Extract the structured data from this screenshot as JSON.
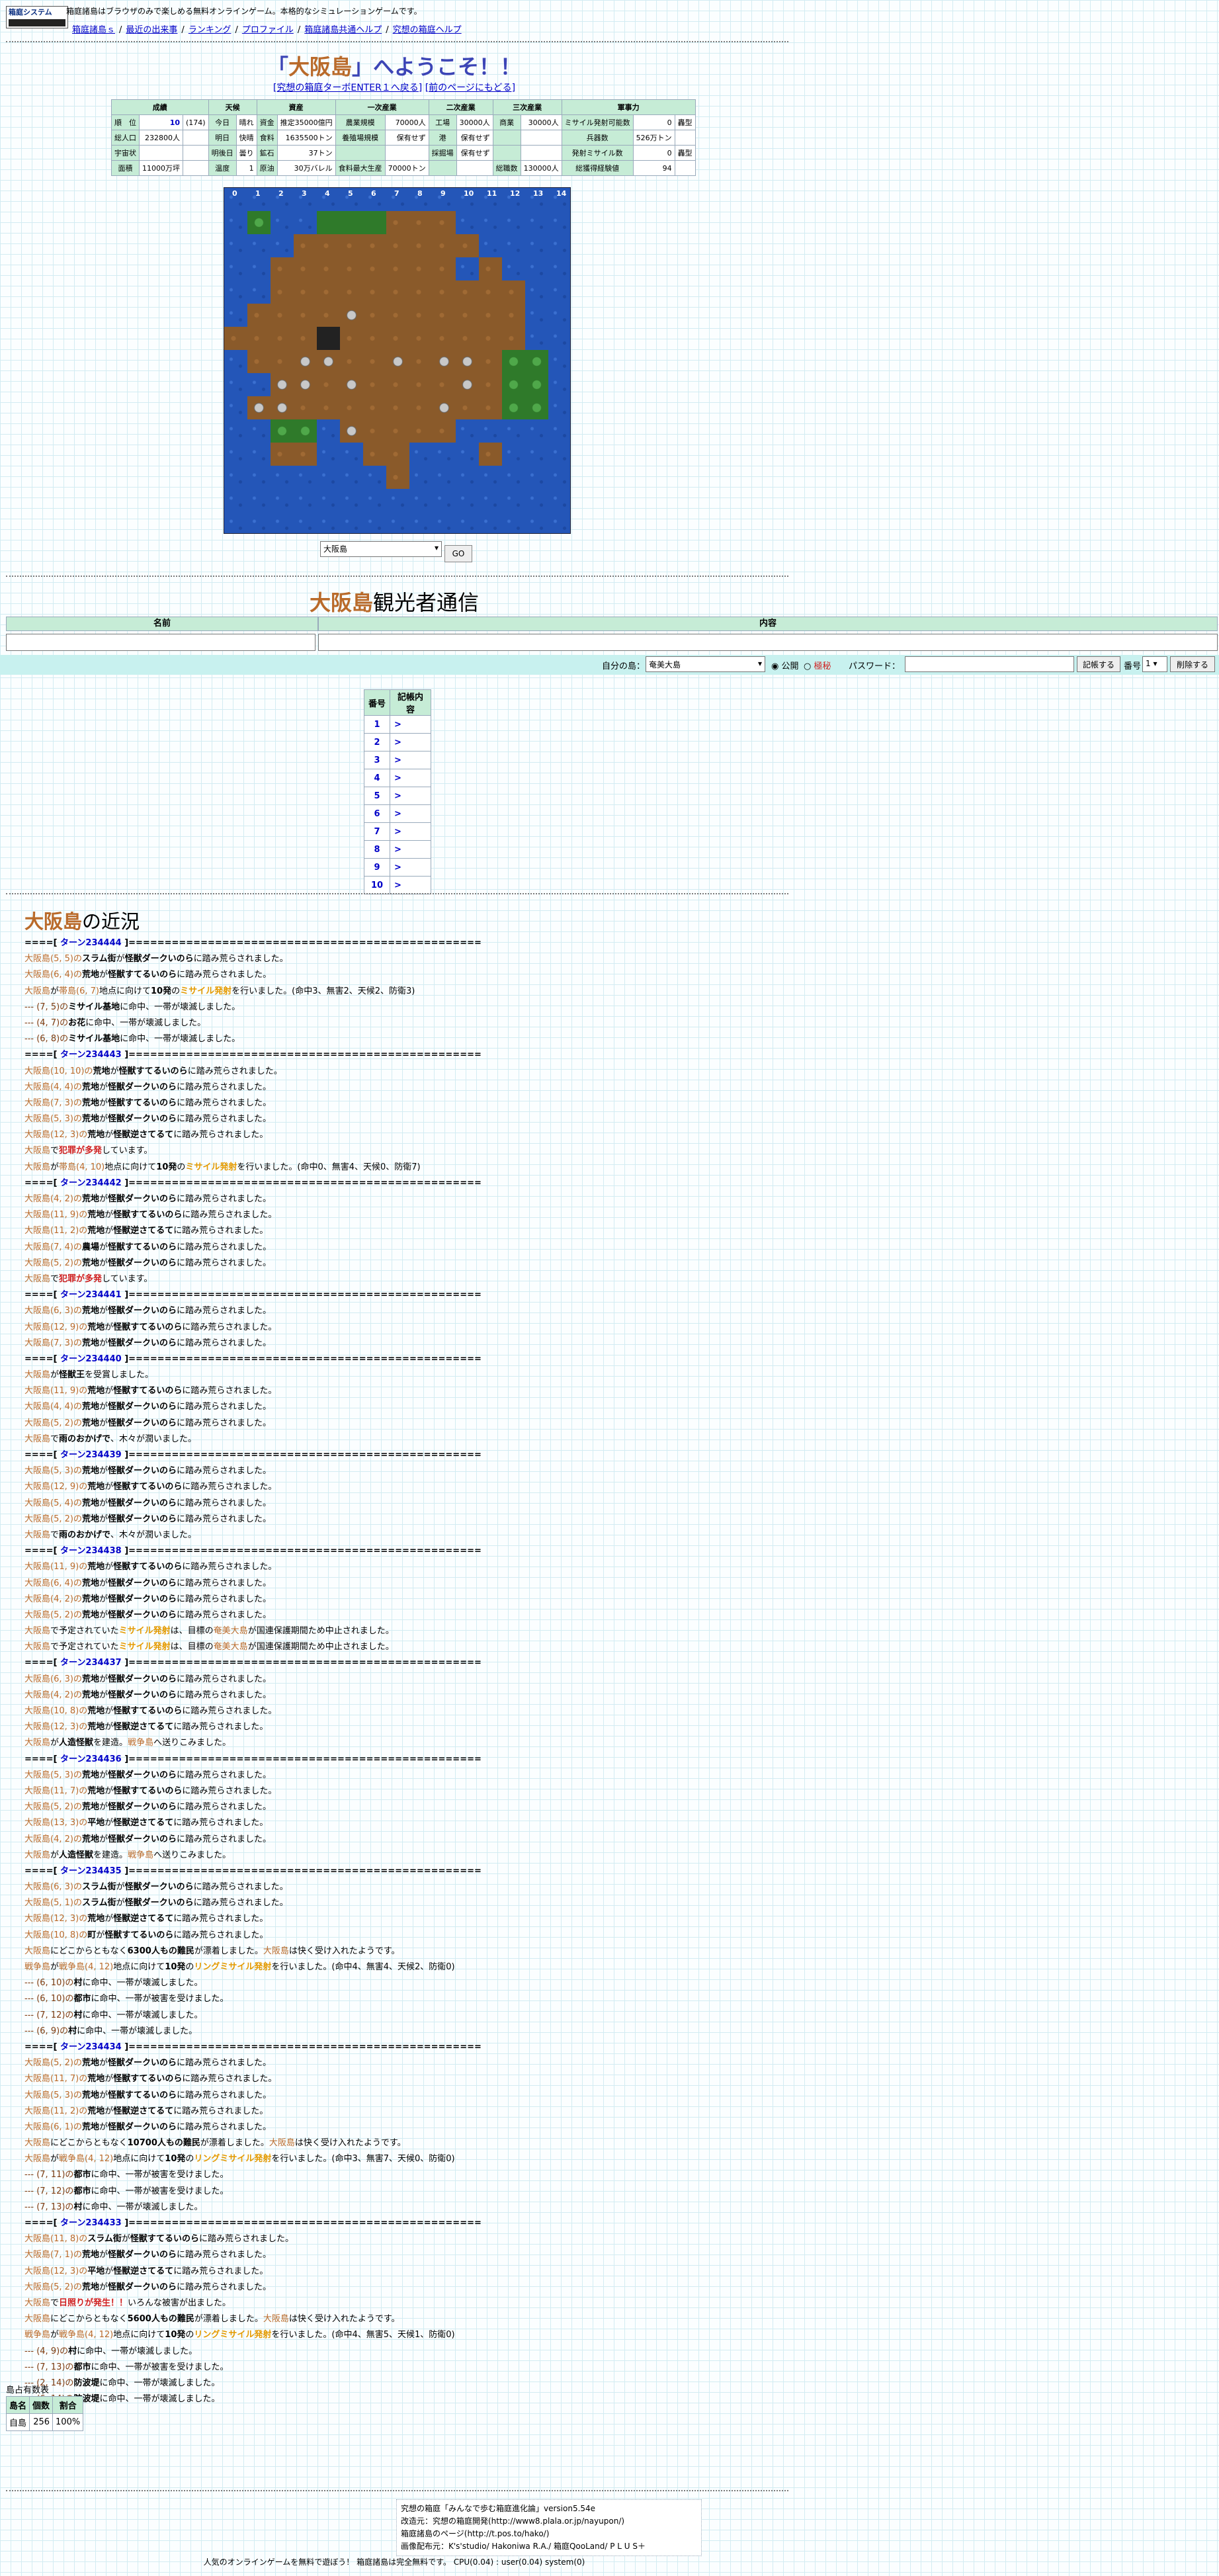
{
  "header": {
    "logo_line1": "箱庭システム",
    "logo_line2": "",
    "tagline": "箱庭諸島はブラウザのみで楽しめる無料オンラインゲーム。本格的なシミュレーションゲームです。",
    "nav": [
      "箱庭諸島ｓ",
      "最近の出来事",
      "ランキング",
      "プロファイル",
      "箱庭諸島共通ヘルプ",
      "究想の箱庭ヘルプ"
    ]
  },
  "welcome": {
    "island": "大阪島",
    "prefix": "「",
    "suffix": "」へようこそ！！"
  },
  "sublinks": {
    "enter": "[究想の箱庭ターボENTER１へ戻る]",
    "back": "[前のページにもどる]"
  },
  "stats": {
    "headers": [
      "成績",
      "天候",
      "資産",
      "一次産業",
      "二次産業",
      "三次産業",
      "軍事力"
    ],
    "rows": [
      [
        "順　位",
        "10",
        "(174)",
        "今日",
        "晴れ",
        "資金",
        "推定35000億円",
        "農業規模",
        "70000人",
        "工場",
        "30000人",
        "商業",
        "30000人",
        "ミサイル発射可能数",
        "0",
        "轟型"
      ],
      [
        "総人口",
        "232800人",
        "",
        "明日",
        "快晴",
        "食料",
        "1635500トン",
        "養殖場規模",
        "保有せず",
        "港",
        "保有せず",
        "",
        "",
        "兵器数",
        "526万トン",
        ""
      ],
      [
        "宇宙状",
        "",
        "",
        "明後日",
        "曇り",
        "鉱石",
        "37トン",
        "",
        "",
        "採掘場",
        "保有せず",
        "",
        "",
        "発射ミサイル数",
        "0",
        "轟型"
      ],
      [
        "面積",
        "11000万坪",
        "",
        "温度",
        "1",
        "原油",
        "30万バレル",
        "食料最大生産",
        "70000トン",
        "",
        "",
        "総職数",
        "130000人",
        "総獲得経験値",
        "94",
        ""
      ]
    ]
  },
  "map": {
    "coords": [
      "0",
      "1",
      "2",
      "3",
      "4",
      "5",
      "6",
      "7",
      "8",
      "9",
      "10",
      "11",
      "12",
      "13",
      "14"
    ]
  },
  "island_select": {
    "selected": "大阪島",
    "go": "GO"
  },
  "observers": {
    "island": "大阪島",
    "suffix": "観光者通信",
    "col_name": "名前",
    "col_content": "内容",
    "your_island_label": "自分の島：",
    "your_island_value": "奄美大島",
    "public": "公開",
    "secret": "極秘",
    "password_label": "パスワード：",
    "memo_button": "記帳する",
    "number_label": "番号",
    "number_value": "1",
    "delete_button": "削除する"
  },
  "memo": {
    "col_no": "番号",
    "col_content": "記帳内容",
    "rows": [
      {
        "no": "1",
        "c": ">"
      },
      {
        "no": "2",
        "c": ">"
      },
      {
        "no": "3",
        "c": ">"
      },
      {
        "no": "4",
        "c": ">"
      },
      {
        "no": "5",
        "c": ">"
      },
      {
        "no": "6",
        "c": ">"
      },
      {
        "no": "7",
        "c": ">"
      },
      {
        "no": "8",
        "c": ">"
      },
      {
        "no": "9",
        "c": ">"
      },
      {
        "no": "10",
        "c": ">"
      }
    ]
  },
  "recent": {
    "island": "大阪島",
    "suffix": "の近況"
  },
  "log": [
    "T|234444",
    "大阪島(5, 5)の|スラム街|が|怪獣ダークいのら|に踏み荒らされました。",
    "大阪島(6, 4)の|荒地|が|怪獣すてるいのら|に踏み荒らされました。",
    "M|大阪島|が|帯島(6, 7)|地点に向けて|10発|の|ミサイル発射|を行いました。(命中3、無害2、天候2、防衛3)",
    "S|--- (7, 5)の|ミサイル基地|に命中、一帯が壊滅しました。",
    "S|--- (4, 7)の|お花|に命中、一帯が壊滅しました。",
    "S|--- (6, 8)の|ミサイル基地|に命中、一帯が壊滅しました。",
    "T|234443",
    "大阪島(10, 10)の|荒地|が|怪獣すてるいのら|に踏み荒らされました。",
    "大阪島(4, 4)の|荒地|が|怪獣ダークいのら|に踏み荒らされました。",
    "大阪島(7, 3)の|荒地|が|怪獣すてるいのら|に踏み荒らされました。",
    "大阪島(5, 3)の|荒地|が|怪獣ダークいのら|に踏み荒らされました。",
    "大阪島(12, 3)の|荒地|が|怪獣逆さてるて|に踏み荒らされました。",
    "C|大阪島|で|犯罪が多発|しています。",
    "M|大阪島|が|帯島(4, 10)|地点に向けて|10発|の|ミサイル発射|を行いました。(命中0、無害4、天候0、防衛7)",
    "T|234442",
    "大阪島(4, 2)の|荒地|が|怪獣ダークいのら|に踏み荒らされました。",
    "大阪島(11, 9)の|荒地|が|怪獣すてるいのら|に踏み荒らされました。",
    "大阪島(11, 2)の|荒地|が|怪獣逆さてるて|に踏み荒らされました。",
    "大阪島(7, 4)の|農場|が|怪獣すてるいのら|に踏み荒らされました。",
    "大阪島(5, 2)の|荒地|が|怪獣ダークいのら|に踏み荒らされました。",
    "C|大阪島|で|犯罪が多発|しています。",
    "T|234441",
    "大阪島(6, 3)の|荒地|が|怪獣ダークいのら|に踏み荒らされました。",
    "大阪島(12, 9)の|荒地|が|怪獣すてるいのら|に踏み荒らされました。",
    "大阪島(7, 3)の|荒地|が|怪獣ダークいのら|に踏み荒らされました。",
    "T|234440",
    "P|大阪島|が|怪獣王|を受賞しました。",
    "大阪島(11, 9)の|荒地|が|怪獣すてるいのら|に踏み荒らされました。",
    "大阪島(4, 4)の|荒地|が|怪獣ダークいのら|に踏み荒らされました。",
    "大阪島(5, 2)の|荒地|が|怪獣ダークいのら|に踏み荒らされました。",
    "P|大阪島|で|雨のおかげで|、木々が潤いました。",
    "T|234439",
    "大阪島(5, 3)の|荒地|が|怪獣ダークいのら|に踏み荒らされました。",
    "大阪島(12, 9)の|荒地|が|怪獣すてるいのら|に踏み荒らされました。",
    "大阪島(5, 4)の|荒地|が|怪獣ダークいのら|に踏み荒らされました。",
    "大阪島(5, 2)の|荒地|が|怪獣ダークいのら|に踏み荒らされました。",
    "P|大阪島|で|雨のおかげで|、木々が潤いました。",
    "T|234438",
    "大阪島(11, 9)の|荒地|が|怪獣すてるいのら|に踏み荒らされました。",
    "大阪島(6, 4)の|荒地|が|怪獣ダークいのら|に踏み荒らされました。",
    "大阪島(4, 2)の|荒地|が|怪獣ダークいのら|に踏み荒らされました。",
    "大阪島(5, 2)の|荒地|が|怪獣ダークいのら|に踏み荒らされました。",
    "X|大阪島|で予定されていた|ミサイル発射|は、目標の|奄美大島|が国連保護期間ため中止されました。",
    "X|大阪島|で予定されていた|ミサイル発射|は、目標の|奄美大島|が国連保護期間ため中止されました。",
    "T|234437",
    "大阪島(6, 3)の|荒地|が|怪獣ダークいのら|に踏み荒らされました。",
    "大阪島(4, 2)の|荒地|が|怪獣ダークいのら|に踏み荒らされました。",
    "大阪島(10, 8)の|荒地|が|怪獣すてるいのら|に踏み荒らされました。",
    "大阪島(12, 3)の|荒地|が|怪獣逆さてるて|に踏み荒らされました。",
    "W|大阪島|が|人造怪獣|を建造。|戦争島|へ送りこみました。",
    "T|234436",
    "大阪島(5, 3)の|荒地|が|怪獣ダークいのら|に踏み荒らされました。",
    "大阪島(11, 7)の|荒地|が|怪獣すてるいのら|に踏み荒らされました。",
    "大阪島(5, 2)の|荒地|が|怪獣ダークいのら|に踏み荒らされました。",
    "大阪島(13, 3)の|平地|が|怪獣逆さてるて|に踏み荒らされました。",
    "大阪島(4, 2)の|荒地|が|怪獣ダークいのら|に踏み荒らされました。",
    "W|大阪島|が|人造怪獣|を建造。|戦争島|へ送りこみました。",
    "T|234435",
    "大阪島(6, 3)の|スラム街|が|怪獣ダークいのら|に踏み荒らされました。",
    "大阪島(5, 1)の|スラム街|が|怪獣ダークいのら|に踏み荒らされました。",
    "大阪島(12, 3)の|荒地|が|怪獣逆さてるて|に踏み荒らされました。",
    "大阪島(10, 8)の|町|が|怪獣すてるいのら|に踏み荒らされました。",
    "R|大阪島|にどこからともなく|6300人もの難民|が漂着しました。|大阪島|は快く受け入れたようです。",
    "N|戦争島|が|戦争島(4, 12)|地点に向けて|10発|の|リングミサイル発射|を行いました。(命中4、無害4、天候2、防衛0)",
    "S|--- (6, 10)の|村|に命中、一帯が壊滅しました。",
    "S|--- (6, 10)の|都市|に命中、一帯が被害を受けました。",
    "S|--- (7, 12)の|村|に命中、一帯が壊滅しました。",
    "S|--- (6, 9)の|村|に命中、一帯が壊滅しました。",
    "T|234434",
    "大阪島(5, 2)の|荒地|が|怪獣ダークいのら|に踏み荒らされました。",
    "大阪島(11, 7)の|荒地|が|怪獣すてるいのら|に踏み荒らされました。",
    "大阪島(5, 3)の|荒地|が|怪獣すてるいのら|に踏み荒らされました。",
    "大阪島(11, 2)の|荒地|が|怪獣逆さてるて|に踏み荒らされました。",
    "大阪島(6, 1)の|荒地|が|怪獣ダークいのら|に踏み荒らされました。",
    "R|大阪島|にどこからともなく|10700人もの難民|が漂着しました。|大阪島|は快く受け入れたようです。",
    "N|大阪島|が|戦争島(4, 12)|地点に向けて|10発|の|リングミサイル発射|を行いました。(命中3、無害7、天候0、防衛0)",
    "S|--- (7, 11)の|都市|に命中、一帯が被害を受けました。",
    "S|--- (7, 12)の|都市|に命中、一帯が被害を受けました。",
    "S|--- (7, 13)の|村|に命中、一帯が壊滅しました。",
    "T|234433",
    "大阪島(11, 8)の|スラム街|が|怪獣すてるいのら|に踏み荒らされました。",
    "大阪島(7, 1)の|荒地|が|怪獣ダークいのら|に踏み荒らされました。",
    "大阪島(12, 3)の|平地|が|怪獣逆さてるて|に踏み荒らされました。",
    "大阪島(5, 2)の|荒地|が|怪獣ダークいのら|に踏み荒らされました。",
    "D|大阪島|で|日照りが発生！！|いろんな被害が出ました。",
    "R|大阪島|にどこからともなく|5600人もの難民|が漂着しました。|大阪島|は快く受け入れたようです。",
    "N|戦争島|が|戦争島(4, 12)|地点に向けて|10発|の|リングミサイル発射|を行いました。(命中4、無害5、天候1、防衛0)",
    "S|--- (4, 9)の|村|に命中、一帯が壊滅しました。",
    "S|--- (7, 13)の|都市|に命中、一帯が被害を受けました。",
    "S|--- (2, 14)の|防波堤|に命中、一帯が壊滅しました。",
    "S|--- (6, 14)の|防波堤|に命中、一帯が壊滅しました。"
  ],
  "ownership": {
    "title": "島占有数表",
    "headers": [
      "島名",
      "個数",
      "割合"
    ],
    "row": [
      "自島",
      "256",
      "100%"
    ]
  },
  "footer": {
    "lines": [
      "究想の箱庭「みんなで歩む箱庭進化論」version5.54e",
      "改造元：究想の箱庭開発(http://www8.plala.or.jp/nayupon/)",
      "箱庭諸島のページ(http://t.pos.to/hako/)",
      "画像配布元：K's'studio/ Hakoniwa R.A./ 箱庭QooLand/ P L U S＋"
    ],
    "bottom": "人気のオンラインゲームを無料で遊ぼう！ 箱庭諸島は完全無料です。 CPU(0.04) : user(0.04) system(0)"
  }
}
